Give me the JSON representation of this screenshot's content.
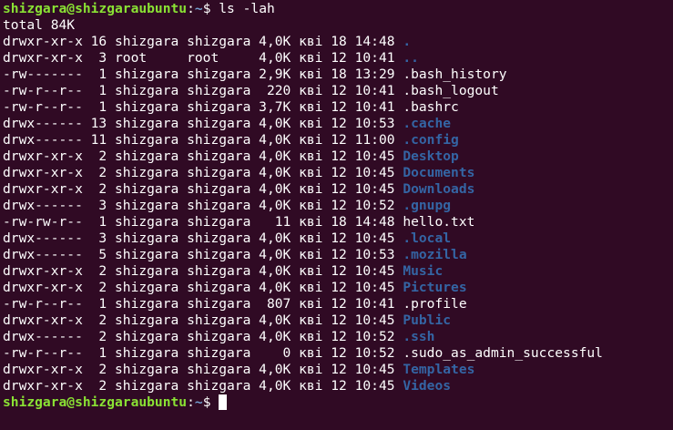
{
  "prompt": {
    "user_host": "shizgara@shizgaraubuntu",
    "sep": ":",
    "path": "~",
    "symbol": "$ "
  },
  "command": "ls -lah",
  "total": "total 84K",
  "rows": [
    {
      "meta": "drwxr-xr-x 16 shizgara shizgara 4,0K кві 18 14:48 ",
      "name": ".",
      "type": "dir"
    },
    {
      "meta": "drwxr-xr-x  3 root     root     4,0K кві 12 10:41 ",
      "name": "..",
      "type": "dir"
    },
    {
      "meta": "-rw-------  1 shizgara shizgara 2,9K кві 18 13:29 ",
      "name": ".bash_history",
      "type": "file"
    },
    {
      "meta": "-rw-r--r--  1 shizgara shizgara  220 кві 12 10:41 ",
      "name": ".bash_logout",
      "type": "file"
    },
    {
      "meta": "-rw-r--r--  1 shizgara shizgara 3,7K кві 12 10:41 ",
      "name": ".bashrc",
      "type": "file"
    },
    {
      "meta": "drwx------ 13 shizgara shizgara 4,0K кві 12 10:53 ",
      "name": ".cache",
      "type": "dir"
    },
    {
      "meta": "drwx------ 11 shizgara shizgara 4,0K кві 12 11:00 ",
      "name": ".config",
      "type": "dir"
    },
    {
      "meta": "drwxr-xr-x  2 shizgara shizgara 4,0K кві 12 10:45 ",
      "name": "Desktop",
      "type": "dir"
    },
    {
      "meta": "drwxr-xr-x  2 shizgara shizgara 4,0K кві 12 10:45 ",
      "name": "Documents",
      "type": "dir"
    },
    {
      "meta": "drwxr-xr-x  2 shizgara shizgara 4,0K кві 12 10:45 ",
      "name": "Downloads",
      "type": "dir"
    },
    {
      "meta": "drwx------  3 shizgara shizgara 4,0K кві 12 10:52 ",
      "name": ".gnupg",
      "type": "dir"
    },
    {
      "meta": "-rw-rw-r--  1 shizgara shizgara   11 кві 18 14:48 ",
      "name": "hello.txt",
      "type": "file"
    },
    {
      "meta": "drwx------  3 shizgara shizgara 4,0K кві 12 10:45 ",
      "name": ".local",
      "type": "dir"
    },
    {
      "meta": "drwx------  5 shizgara shizgara 4,0K кві 12 10:53 ",
      "name": ".mozilla",
      "type": "dir"
    },
    {
      "meta": "drwxr-xr-x  2 shizgara shizgara 4,0K кві 12 10:45 ",
      "name": "Music",
      "type": "dir"
    },
    {
      "meta": "drwxr-xr-x  2 shizgara shizgara 4,0K кві 12 10:45 ",
      "name": "Pictures",
      "type": "dir"
    },
    {
      "meta": "-rw-r--r--  1 shizgara shizgara  807 кві 12 10:41 ",
      "name": ".profile",
      "type": "file"
    },
    {
      "meta": "drwxr-xr-x  2 shizgara shizgara 4,0K кві 12 10:45 ",
      "name": "Public",
      "type": "dir"
    },
    {
      "meta": "drwx------  2 shizgara shizgara 4,0K кві 12 10:52 ",
      "name": ".ssh",
      "type": "dir"
    },
    {
      "meta": "-rw-r--r--  1 shizgara shizgara    0 кві 12 10:52 ",
      "name": ".sudo_as_admin_successful",
      "type": "file"
    },
    {
      "meta": "drwxr-xr-x  2 shizgara shizgara 4,0K кві 12 10:45 ",
      "name": "Templates",
      "type": "dir"
    },
    {
      "meta": "drwxr-xr-x  2 shizgara shizgara 4,0K кві 12 10:45 ",
      "name": "Videos",
      "type": "dir"
    }
  ],
  "colors": {
    "background": "#300a24",
    "prompt_user": "#8ae234",
    "prompt_path": "#729fcf",
    "directory": "#3465a4",
    "text": "#ffffff"
  }
}
